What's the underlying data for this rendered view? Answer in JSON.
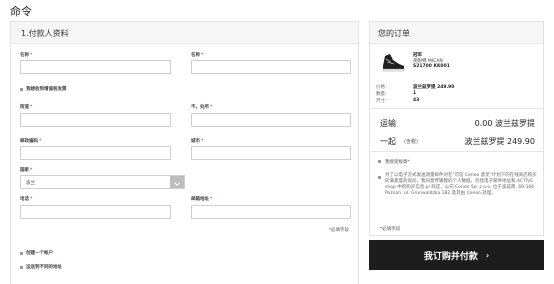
{
  "page_title": "命令",
  "billing": {
    "heading": "1.付款人资料",
    "required_mark": "*",
    "first_name_label": "名称",
    "last_name_label": "名称",
    "invoice_checkbox": "我想收到增值税发票",
    "street_label": "街道",
    "number_label": "不。处所",
    "postcode_label": "邮政编码",
    "city_label": "城市",
    "country_label": "国家",
    "country_value": "波兰",
    "phone_label": "电话",
    "email_label": "邮箱地址",
    "required_note": "*必填字段",
    "create_account": "创建一个帐户",
    "ship_other_address": "运送到不同的地址"
  },
  "order": {
    "heading": "您的订单",
    "product_name": "冠军",
    "product_brand": "英耐特 MICAN",
    "product_code": "S21700 KK001",
    "price_label": "价格：",
    "price_value": "波兰兹罗提 249.90",
    "qty_label": "数量：",
    "qty_value": "1",
    "size_label": "尺寸：",
    "size_value": "43",
    "shipping_label": "运输",
    "shipping_value": "0.00 波兰兹罗提",
    "total_label": "一起",
    "total_sub": "(含税)",
    "total_value": "波兰兹罗提 249.90",
    "terms_checkbox": "我接受规章*",
    "consent_text": "为了以电子方式发送测量邮件对在\"可信 Ceneo 意见\"计划下的在线商店购买的满意度的询问，我同意传输我的个人数据，包括电子邮件地址和 ACTIVE shop 中的购买信息.pl 商店，公司 Ceneo Sp. z o.o. 位于波兹南, 60-166 Poznań, ul. Grunwaldzka 182 及其由 Ceneo 处理。",
    "required_note": "*必填字段",
    "buy_button": "我订购并付款",
    "buy_chevron": "›"
  }
}
